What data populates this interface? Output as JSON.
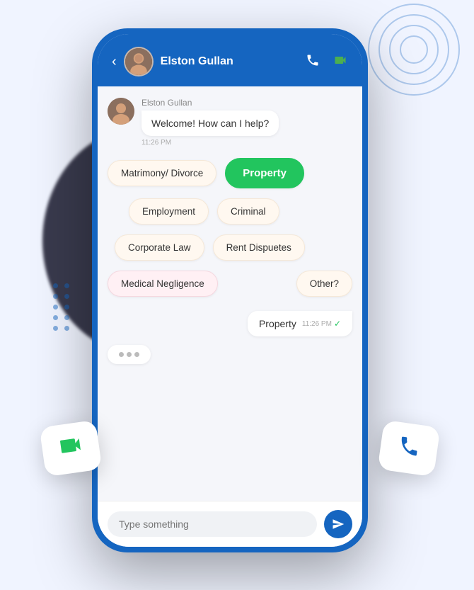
{
  "header": {
    "back_label": "‹",
    "user_name": "Elston Gullan",
    "call_icon": "📞",
    "video_icon": "📹"
  },
  "chat": {
    "welcome_message": "Welcome! How can I help?",
    "message_time": "11:26 PM",
    "sender_name": "Elston Gullan"
  },
  "options": [
    {
      "label": "Matrimony/ Divorce",
      "style": "default"
    },
    {
      "label": "Property",
      "style": "selected"
    },
    {
      "label": "Employment",
      "style": "default"
    },
    {
      "label": "Criminal",
      "style": "default"
    },
    {
      "label": "Corporate Law",
      "style": "default"
    },
    {
      "label": "Rent Dispuetes",
      "style": "default"
    },
    {
      "label": "Medical Negligence",
      "style": "pink"
    },
    {
      "label": "Other?",
      "style": "default"
    }
  ],
  "sent_message": {
    "text": "Property",
    "time": "11:26 PM",
    "status": "✓"
  },
  "typing": {
    "dots": [
      "•",
      "•",
      "•"
    ]
  },
  "input": {
    "placeholder": "Type something"
  },
  "float_cards": {
    "video_label": "video-camera",
    "phone_label": "phone-call"
  },
  "decorations": {
    "signal_rings_count": 4
  }
}
